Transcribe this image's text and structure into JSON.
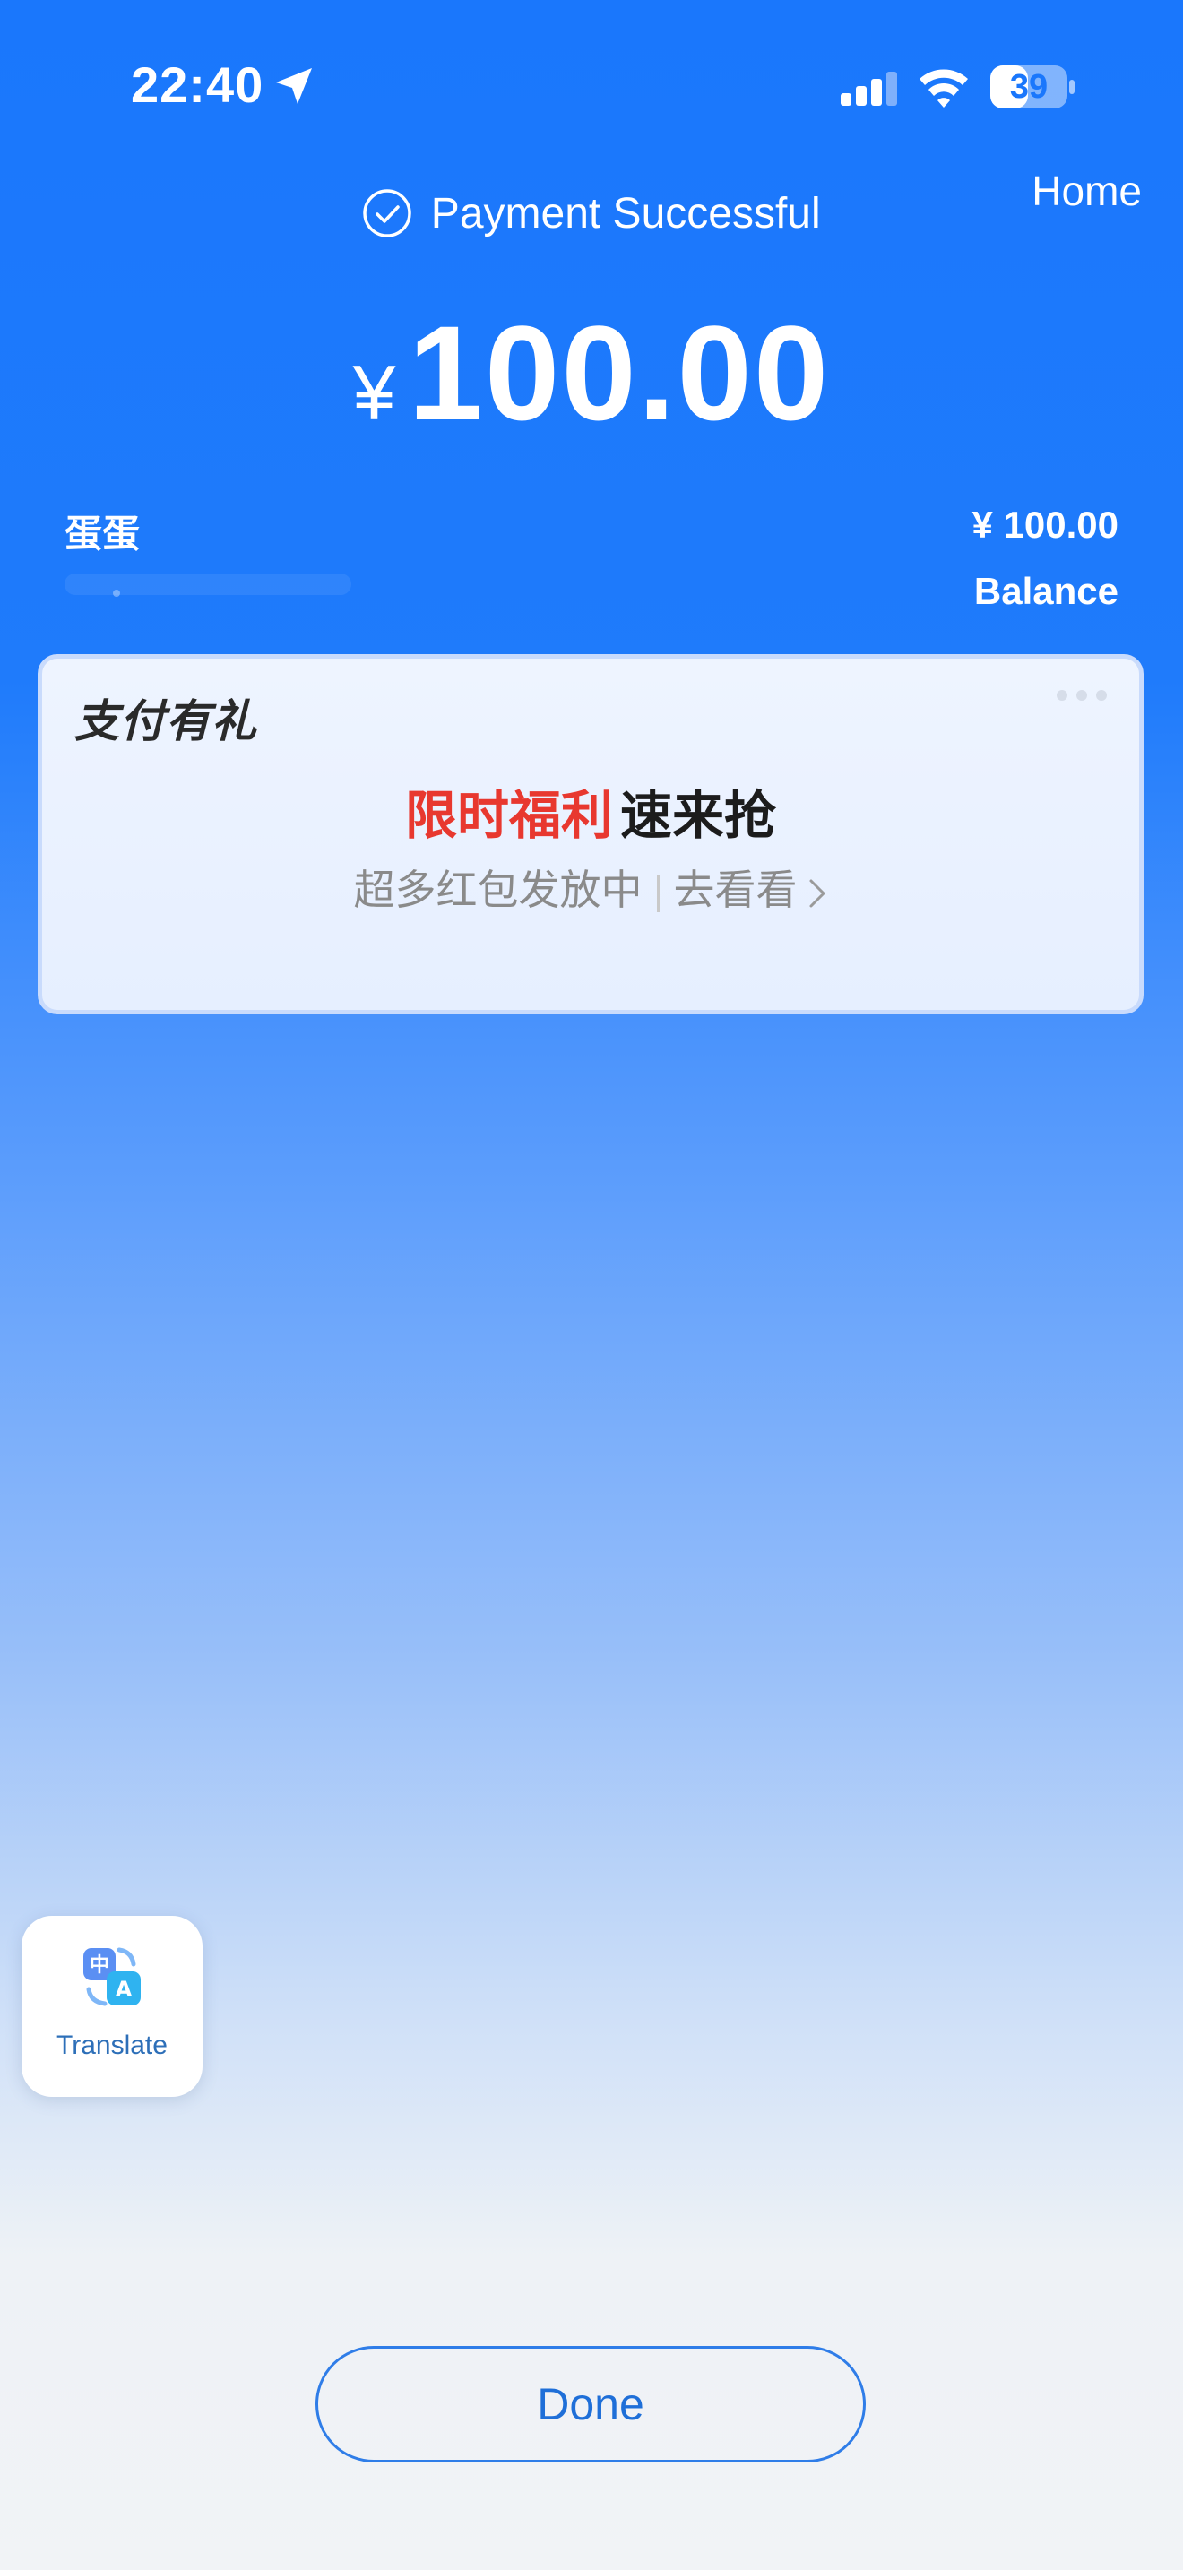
{
  "status_bar": {
    "time": "22:40",
    "battery": "39",
    "icons": [
      "location-arrow-icon",
      "cellular-signal-icon",
      "wifi-icon",
      "battery-icon"
    ]
  },
  "header": {
    "home_label": "Home",
    "status_text": "Payment Successful",
    "currency_symbol": "¥",
    "amount": "100.00"
  },
  "details": {
    "payee": "蛋蛋",
    "amount": "¥ 100.00",
    "method": "Balance"
  },
  "promo": {
    "brand": "支付有礼",
    "headline_highlight": "限时福利",
    "headline_rest": "速来抢",
    "subtitle": "超多红包发放中",
    "link": "去看看"
  },
  "translate": {
    "label": "Translate",
    "icon_text_zh": "中",
    "icon_text_en": "A"
  },
  "footer": {
    "done_label": "Done"
  },
  "colors": {
    "accent": "#1a77fc",
    "promo_red": "#e8382f",
    "done_border": "#2f7de8"
  }
}
